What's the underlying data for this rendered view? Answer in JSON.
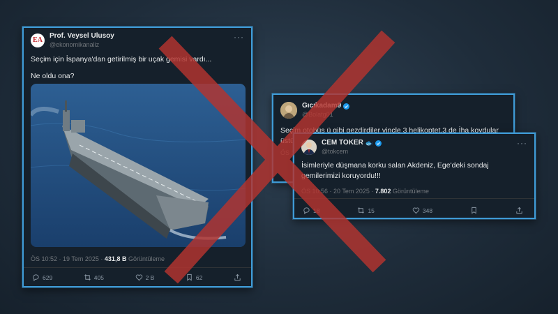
{
  "colors": {
    "background": "#1f2d3b",
    "card": "#15202b",
    "card_border": "#3f9bd6",
    "verified": "#1d9bf0",
    "cross": "#b5342f"
  },
  "tweets": [
    {
      "display_name": "Prof. Veysel Ulusoy",
      "handle": "@ekonomikanaliz",
      "avatar_text": "EA",
      "more_icon": "more-icon",
      "text_lines": [
        "Seçim için İspanya'dan getirilmiş bir uçak gemisi vardı...",
        "Ne oldu ona?"
      ],
      "time": "ÖS 10:52 · 19 Tem 2025 ·",
      "views": "431,8 B",
      "views_label": "Görüntüleme",
      "actions": {
        "replies": "629",
        "retweets": "405",
        "likes": "2 B",
        "bookmarks": "62"
      }
    },
    {
      "display_name": "Gıcıkadam9",
      "handle": "@Bolatg01",
      "verified": true,
      "text": "Seçim otobüs ü gibi gezdirdiler vinçle 3 helikoptet,3 de İha koydular üstü",
      "time": "ÖS 1"
    },
    {
      "display_name": "CEM TOKER",
      "handle": "@tokcem",
      "verified": true,
      "text": "İsimleriyle düşmana korku salan Akdeniz, Ege'deki sondaj gemilerimizi koruyordu!!!",
      "time": "ÖS 10:56 · 20 Tem 2025 ·",
      "views": "7.802",
      "views_label": "Görüntüleme",
      "actions": {
        "replies": "18",
        "retweets": "15",
        "likes": "348"
      }
    }
  ]
}
